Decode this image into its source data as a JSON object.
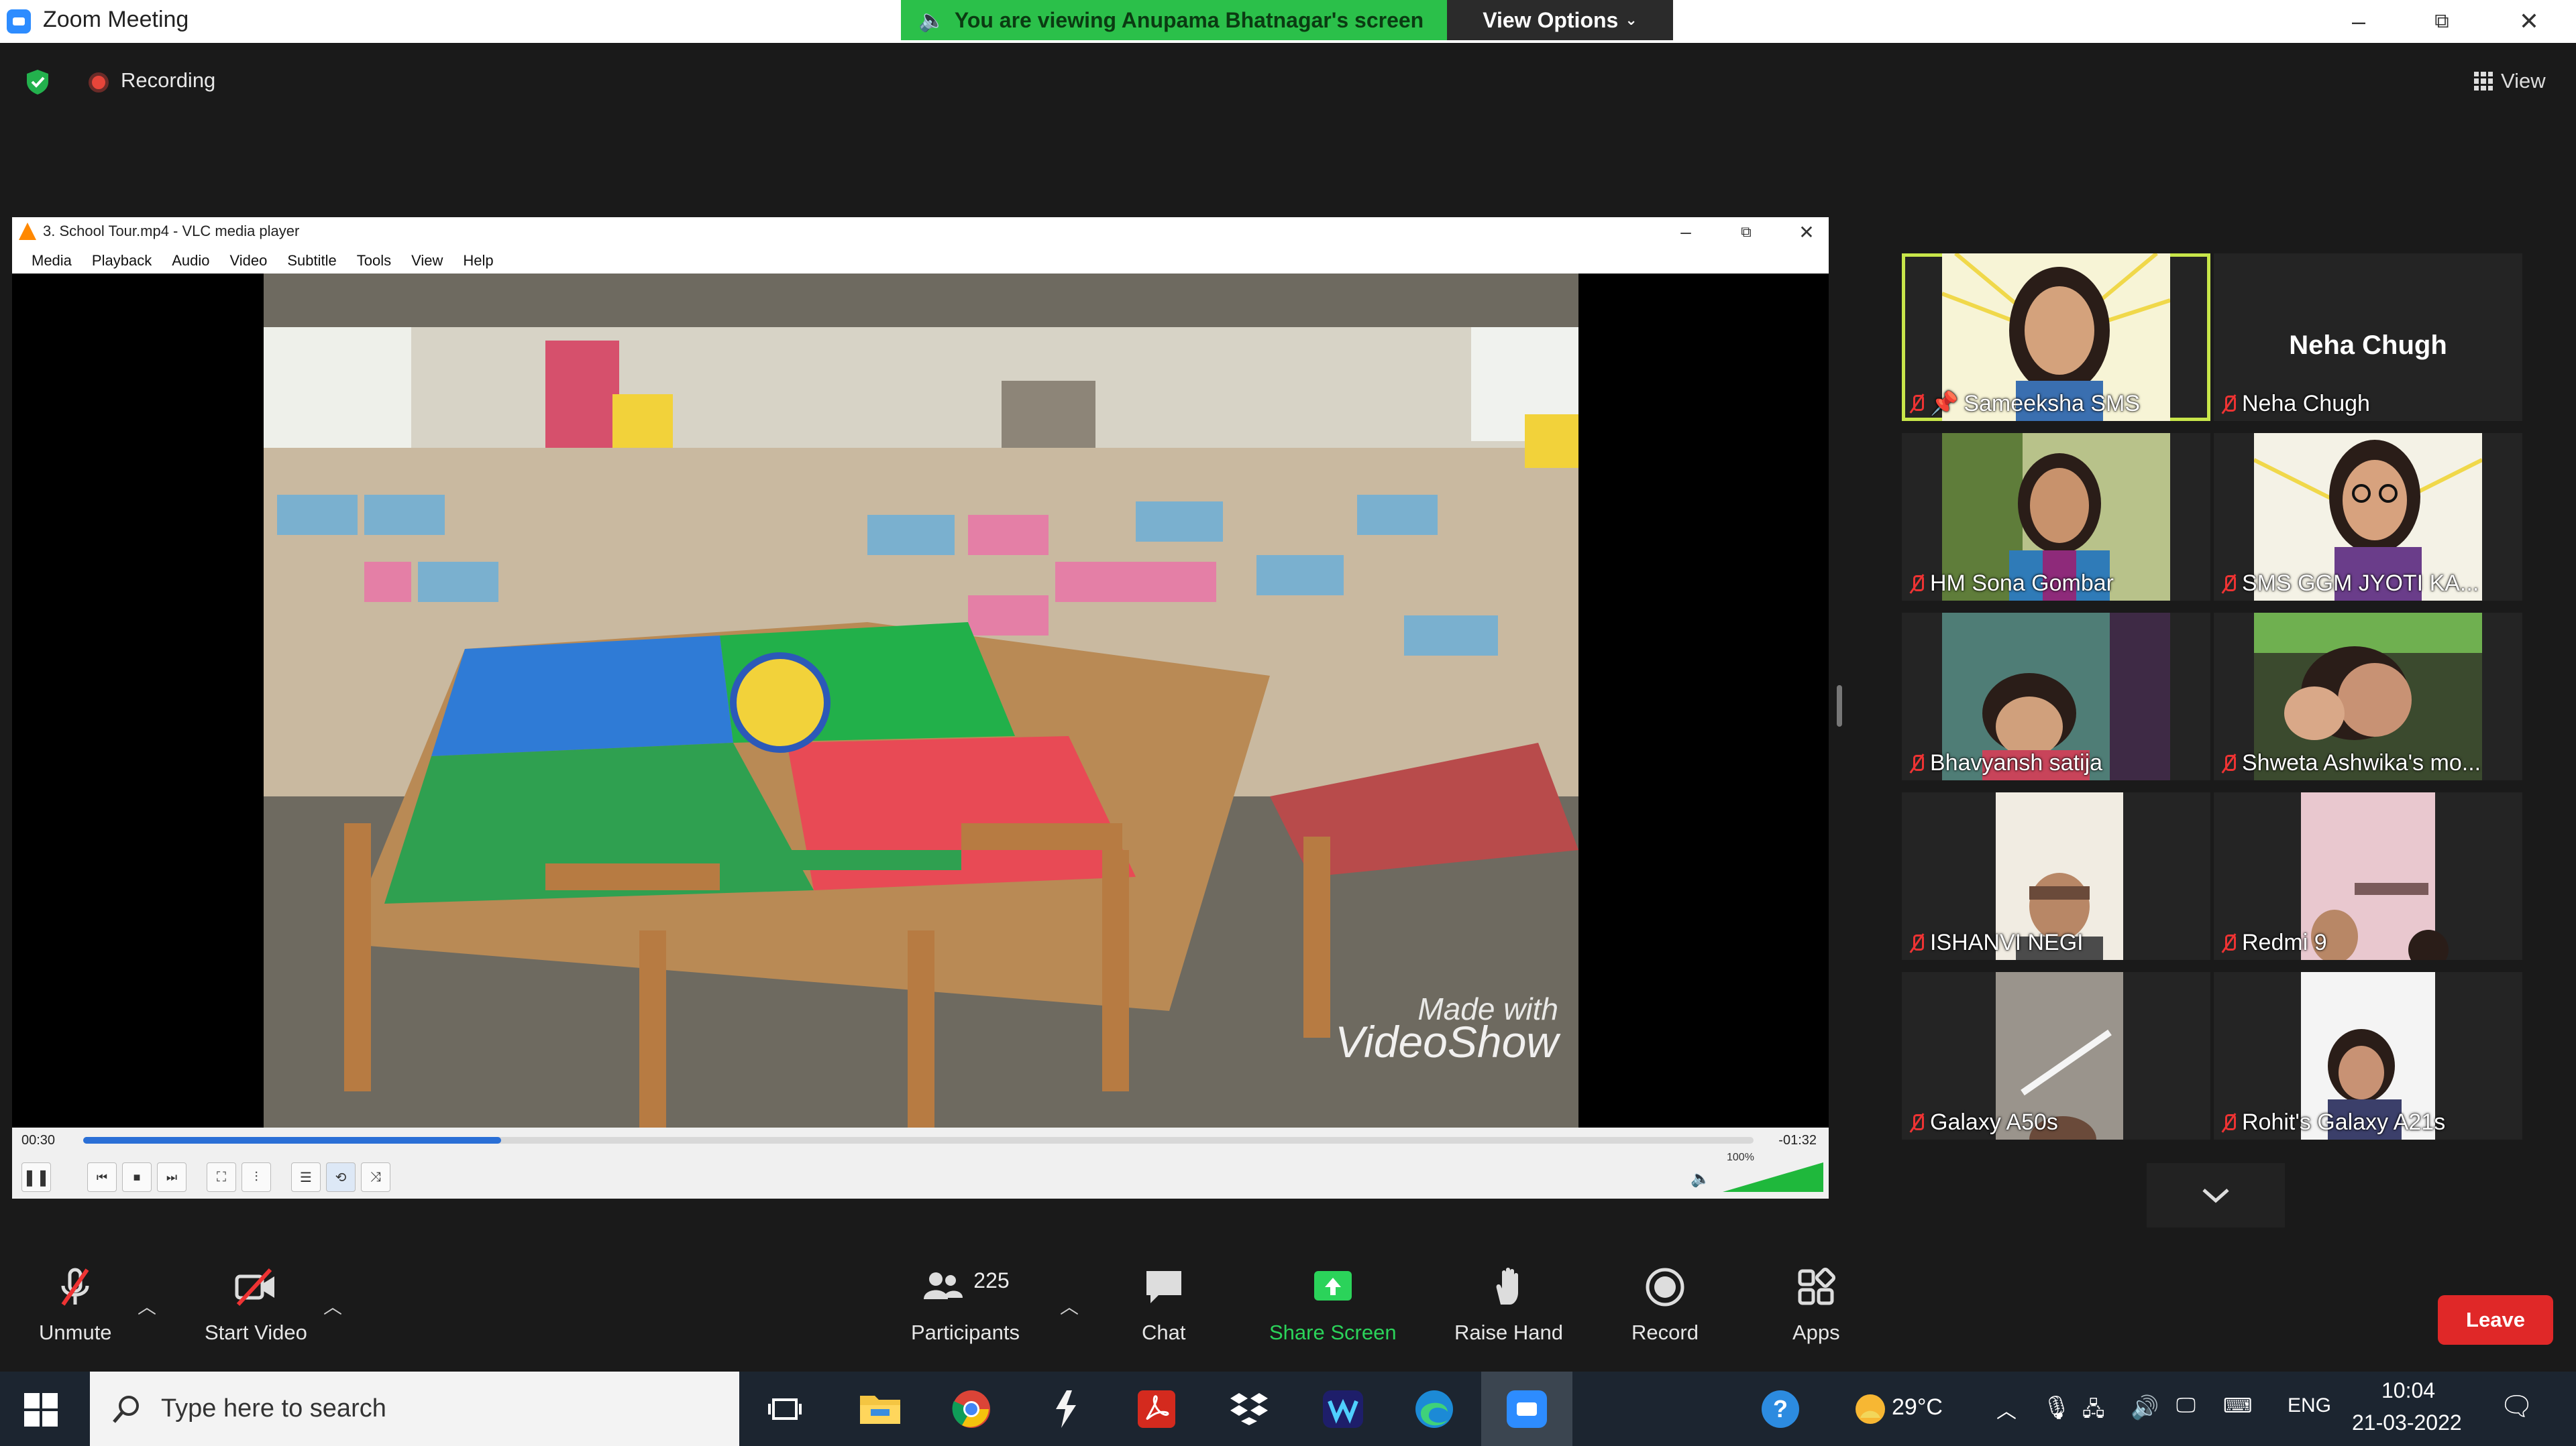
{
  "window": {
    "title": "Zoom Meeting",
    "share_banner": "You are viewing Anupama Bhatnagar's screen",
    "view_options": "View Options",
    "controls": {
      "minimize": "–",
      "restore": "⧉",
      "close": "✕"
    }
  },
  "meeting_bar": {
    "recording_label": "Recording",
    "view_label": "View"
  },
  "vlc": {
    "title": "3. School Tour.mp4 - VLC media player",
    "menu": [
      "Media",
      "Playback",
      "Audio",
      "Video",
      "Subtitle",
      "Tools",
      "View",
      "Help"
    ],
    "time_elapsed": "00:30",
    "time_remaining": "-01:32",
    "progress": 0.25,
    "volume_label": "100%",
    "volume": 1.0,
    "watermark_line1": "Made with",
    "watermark_line2": "VideoShow"
  },
  "gallery": {
    "tiles": [
      {
        "name": "Sameeksha SMS",
        "active": true,
        "has_video": true
      },
      {
        "name": "Neha Chugh",
        "big_name": "Neha Chugh",
        "has_video": false
      },
      {
        "name": "HM Sona Gombar",
        "has_video": true
      },
      {
        "name": "SMS  GGM  JYOTI KA...",
        "has_video": true
      },
      {
        "name": "Bhavyansh satija",
        "has_video": true
      },
      {
        "name": "Shweta Ashwika's mo...",
        "has_video": true
      },
      {
        "name": "ISHANVI NEGI",
        "has_video": true
      },
      {
        "name": "Redmi 9",
        "has_video": true
      },
      {
        "name": "Galaxy A50s",
        "has_video": true
      },
      {
        "name": "Rohit's Galaxy A21s",
        "has_video": true
      }
    ]
  },
  "toolbar": {
    "unmute": "Unmute",
    "start_video": "Start Video",
    "participants": "Participants",
    "participants_count": "225",
    "chat": "Chat",
    "share_screen": "Share Screen",
    "raise_hand": "Raise Hand",
    "record": "Record",
    "apps": "Apps",
    "leave": "Leave",
    "share_color": "#2bd35a"
  },
  "taskbar": {
    "search_placeholder": "Type here to search",
    "weather": "29°C",
    "language": "ENG",
    "time": "10:04",
    "date": "21-03-2022"
  }
}
